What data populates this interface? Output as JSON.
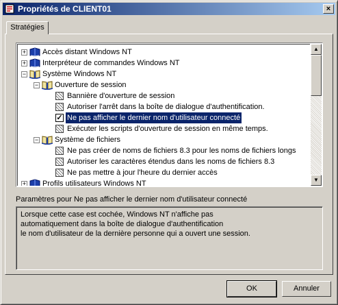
{
  "window": {
    "title": "Propriétés de CLIENT01",
    "close_glyph": "×"
  },
  "tabs": [
    {
      "label": "Stratégies"
    }
  ],
  "tree": {
    "items": [
      {
        "label": "Accès distant Windows NT",
        "level": 0,
        "expander": "+",
        "icon": "book-icon"
      },
      {
        "label": "Interpréteur de commandes Windows NT",
        "level": 0,
        "expander": "+",
        "icon": "book-icon"
      },
      {
        "label": "Système Windows NT",
        "level": 0,
        "expander": "−",
        "icon": "open-book-icon"
      },
      {
        "label": "Ouverture de session",
        "level": 1,
        "expander": "−",
        "icon": "open-book-icon"
      },
      {
        "label": "Bannière d'ouverture de session",
        "level": 2,
        "icon": "policy-icon"
      },
      {
        "label": "Autoriser l'arrêt dans la boîte de dialogue d'authentification.",
        "level": 2,
        "icon": "policy-icon"
      },
      {
        "label": "Ne pas afficher le dernier nom d'utilisateur connecté",
        "level": 2,
        "icon": "checkbox-checked",
        "selected": true
      },
      {
        "label": "Exécuter les scripts d'ouverture de session en même temps.",
        "level": 2,
        "icon": "policy-icon"
      },
      {
        "label": "Système de fichiers",
        "level": 1,
        "expander": "−",
        "icon": "open-book-icon"
      },
      {
        "label": "Ne pas créer de noms de fichiers 8.3 pour les noms de fichiers longs",
        "level": 2,
        "icon": "policy-icon"
      },
      {
        "label": "Autoriser les caractères étendus dans les noms de fichiers 8.3",
        "level": 2,
        "icon": "policy-icon"
      },
      {
        "label": "Ne pas mettre à jour l'heure du dernier accès",
        "level": 2,
        "icon": "policy-icon"
      },
      {
        "label": "Profils utilisateurs Windows NT",
        "level": 0,
        "expander": "+",
        "icon": "book-icon"
      }
    ]
  },
  "description": {
    "label": "Paramètres pour Ne pas afficher le dernier nom d'utilisateur connecté",
    "lines": [
      "Lorsque cette case est cochée, Windows NT n'affiche pas",
      "automatiquement dans la boîte de dialogue d'authentification",
      "le nom d'utilisateur de la dernière personne qui a ouvert une session."
    ]
  },
  "buttons": {
    "ok": "OK",
    "cancel": "Annuler"
  }
}
